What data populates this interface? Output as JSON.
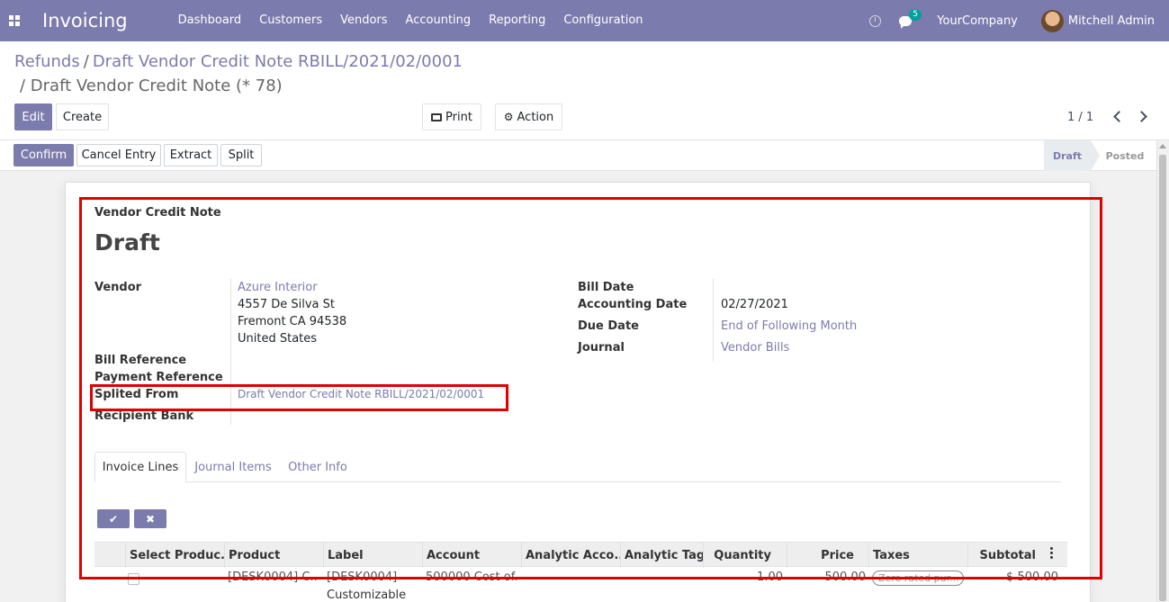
{
  "navbar": {
    "app_name": "Invoicing",
    "menu": [
      "Dashboard",
      "Customers",
      "Vendors",
      "Accounting",
      "Reporting",
      "Configuration"
    ],
    "chat_count": "5",
    "company": "YourCompany",
    "user": "Mitchell Admin",
    "color": "#7c7bad"
  },
  "breadcrumb": {
    "parent": "Refunds",
    "sep": "/",
    "middle": "Draft Vendor Credit Note RBILL/2021/02/0001",
    "current": "/ Draft Vendor Credit Note (* 78)"
  },
  "control": {
    "edit": "Edit",
    "create": "Create",
    "print": "Print",
    "action": "Action",
    "pager": "1 / 1"
  },
  "statusbar": {
    "buttons": [
      "Confirm",
      "Cancel Entry",
      "Extract",
      "Split"
    ],
    "stages": [
      "Draft",
      "Posted"
    ],
    "active_stage": "Draft"
  },
  "form": {
    "doc_type": "Vendor Credit Note",
    "state": "Draft",
    "vendor_label": "Vendor",
    "vendor_name": "Azure Interior",
    "vendor_address": [
      "4557 De Silva St",
      "Fremont CA 94538",
      "United States"
    ],
    "bill_reference_label": "Bill Reference",
    "payment_reference_label": "Payment Reference",
    "splited_from_label": "Splited From",
    "splited_from_value": "Draft Vendor Credit Note RBILL/2021/02/0001",
    "recipient_bank_label": "Recipient Bank",
    "bill_date_label": "Bill Date",
    "accounting_date_label": "Accounting Date",
    "accounting_date_value": "02/27/2021",
    "due_date_label": "Due Date",
    "due_date_value": "End of Following Month",
    "journal_label": "Journal",
    "journal_value": "Vendor Bills"
  },
  "tabs": [
    "Invoice Lines",
    "Journal Items",
    "Other Info"
  ],
  "table": {
    "headers": [
      "Select Produc...",
      "Product",
      "Label",
      "Account",
      "Analytic Acco...",
      "Analytic Tags",
      "Quantity",
      "Price",
      "Taxes",
      "Subtotal"
    ],
    "row": {
      "product": "[DESK0004] C...",
      "label_line1": "[DESK0004]",
      "label_line2": "Customizable",
      "account": "500000 Cost of...",
      "quantity": "1.00",
      "price": "500.00",
      "tax": "Zero rated pur...",
      "subtotal": "$ 500.00"
    }
  },
  "highlight_color": "#e00000"
}
